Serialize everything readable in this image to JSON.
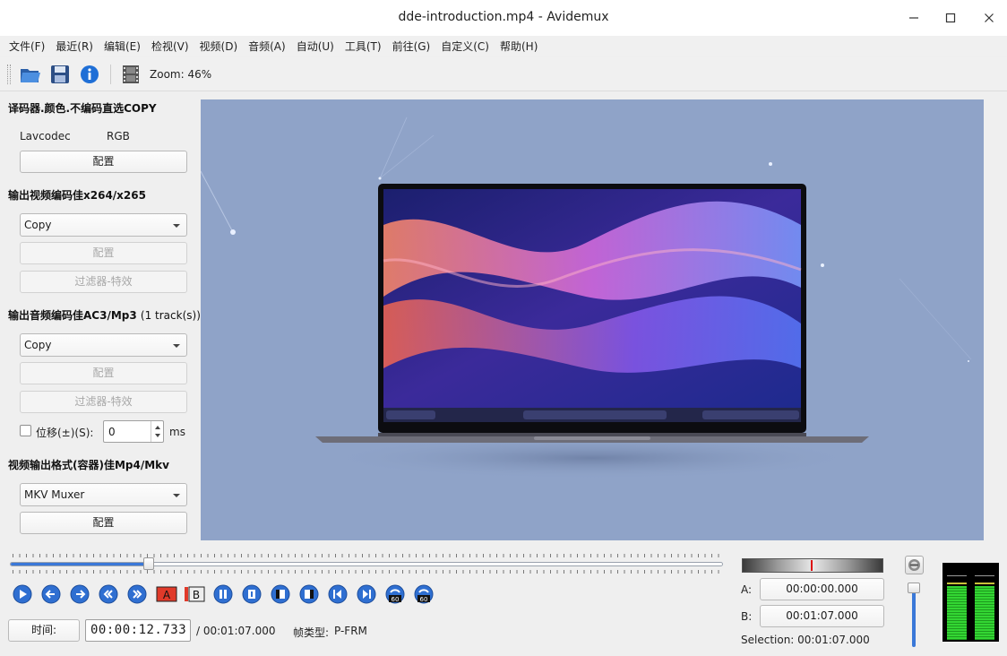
{
  "window": {
    "title": "dde-introduction.mp4 - Avidemux"
  },
  "menu": [
    "文件(F)",
    "最近(R)",
    "编辑(E)",
    "检视(V)",
    "视频(D)",
    "音频(A)",
    "自动(U)",
    "工具(T)",
    "前往(G)",
    "自定义(C)",
    "帮助(H)"
  ],
  "toolbar": {
    "icons": [
      "open-folder-icon",
      "save-disk-icon",
      "info-icon",
      "filmstrip-icon"
    ],
    "zoom_label": "Zoom: 46%"
  },
  "decoder": {
    "heading": "译码器.颜色.不编码直选COPY",
    "codec": "Lavcodec",
    "color": "RGB",
    "config_label": "配置"
  },
  "video_output": {
    "heading": "输出视频编码佳x264/x265",
    "codec_value": "Copy",
    "config_label": "配置",
    "filters_label": "过滤器-特效"
  },
  "audio_output": {
    "heading": "输出音频编码佳AC3/Mp3",
    "tracks": "(1 track(s))",
    "codec_value": "Copy",
    "config_label": "配置",
    "filters_label": "过滤器-特效",
    "shift_label": "位移(±)(S):",
    "shift_value": "0",
    "shift_unit": "ms",
    "shift_checked": false
  },
  "container": {
    "heading": "视频输出格式(容器)佳Mp4/Mkv",
    "muxer_value": "MKV Muxer",
    "config_label": "配置"
  },
  "playback": {
    "position_fraction": 0.195,
    "controls": [
      "play-icon",
      "rewind-icon",
      "forward-icon",
      "prev-frame-icon",
      "next-frame-icon",
      "set-marker-a-icon",
      "set-marker-b-icon",
      "prev-cut-icon",
      "next-cut-icon",
      "goto-marker-a-icon",
      "goto-marker-b-icon",
      "prev-keyframe-icon",
      "next-keyframe-icon",
      "back-60s-icon",
      "forward-60s-icon"
    ],
    "time_button": "时间:",
    "current_time": "00:00:12.733",
    "total_time": "/ 00:01:07.000",
    "frame_type_label": "帧类型:",
    "frame_type_value": "P-FRM"
  },
  "selection": {
    "a_label": "A:",
    "a_value": "00:00:00.000",
    "b_label": "B:",
    "b_value": "00:01:07.000",
    "selection_text": "Selection: 00:01:07.000"
  },
  "colors": {
    "accent": "#3a78d8",
    "video_bg": "#8fa3c8",
    "meter_green": "#33d633"
  }
}
